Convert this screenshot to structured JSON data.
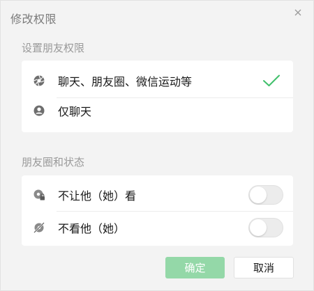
{
  "dialog": {
    "title": "修改权限",
    "close_icon": "close-icon"
  },
  "section_permissions": {
    "title": "设置朋友权限",
    "options": [
      {
        "label": "聊天、朋友圈、微信运动等",
        "icon": "aperture-icon",
        "selected": true
      },
      {
        "label": "仅聊天",
        "icon": "user-circle-icon",
        "selected": false
      }
    ],
    "check_color": "#3fbf6a"
  },
  "section_moments": {
    "title": "朋友圈和状态",
    "options": [
      {
        "label": "不让他（她）看",
        "icon": "moments-lock-icon",
        "enabled": false
      },
      {
        "label": "不看他（她）",
        "icon": "moments-hidden-icon",
        "enabled": false
      }
    ]
  },
  "buttons": {
    "ok_label": "确定",
    "cancel_label": "取消",
    "ok_color": "#94d8a8"
  }
}
